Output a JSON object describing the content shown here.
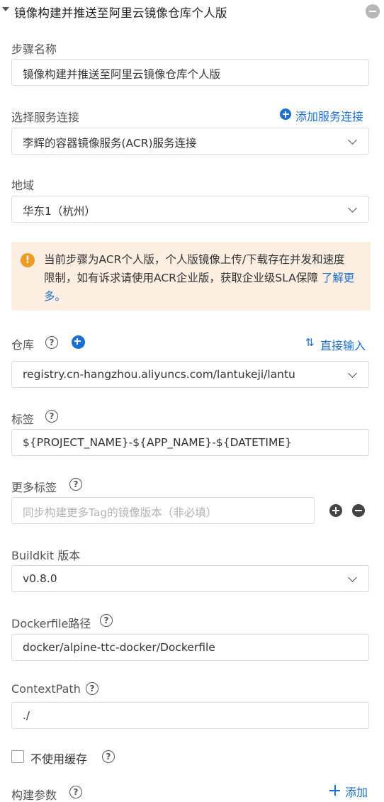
{
  "header": {
    "title": "镜像构建并推送至阿里云镜像仓库个人版"
  },
  "step_name": {
    "label": "步骤名称",
    "value": "镜像构建并推送至阿里云镜像仓库个人版"
  },
  "service_connection": {
    "label": "选择服务连接",
    "add_link": "添加服务连接",
    "value": "李辉的容器镜像服务(ACR)服务连接"
  },
  "region": {
    "label": "地域",
    "value": "华东1（杭州）"
  },
  "alert": {
    "message": "当前步骤为ACR个人版，个人版镜像上传/下载存在并发和速度限制，如有诉求请使用ACR企业版，获取企业级SLA保障",
    "link_text": "了解更多。"
  },
  "repository": {
    "label": "仓库",
    "direct_input": "直接输入",
    "value": "registry.cn-hangzhou.aliyuncs.com/lantukeji/lantu"
  },
  "tag": {
    "label": "标签",
    "value": "${PROJECT_NAME}-${APP_NAME}-${DATETIME}"
  },
  "more_tags": {
    "label": "更多标签",
    "placeholder": "同步构建更多Tag的镜像版本（非必填）"
  },
  "buildkit": {
    "label": "Buildkit 版本",
    "value": "v0.8.0"
  },
  "dockerfile": {
    "label": "Dockerfile路径",
    "value": "docker/alpine-ttc-docker/Dockerfile"
  },
  "context_path": {
    "label": "ContextPath",
    "value": "./"
  },
  "no_cache": {
    "label": "不使用缓存",
    "checked": false
  },
  "build_args": {
    "label": "构建参数",
    "add_link": "添加"
  },
  "help_glyph": "?",
  "colors": {
    "link": "#1b6fd1",
    "alert_bg": "#fdeee2",
    "warning": "#f19a23"
  }
}
